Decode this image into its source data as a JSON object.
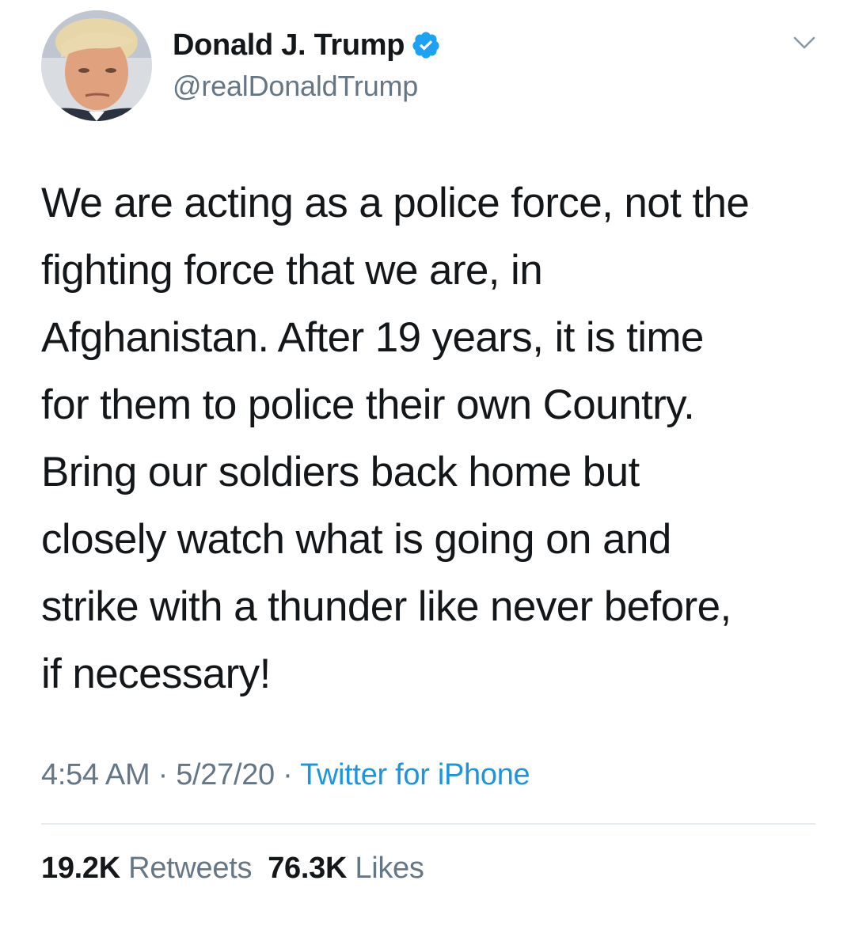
{
  "author": {
    "display_name": "Donald J. Trump",
    "handle": "@realDonaldTrump",
    "verified": true,
    "verified_icon": "verified-badge-icon",
    "avatar": "profile-photo"
  },
  "tweet": {
    "lines": [
      "We are acting as a police force, not the",
      "fighting force that we are, in",
      "Afghanistan. After 19 years, it is time",
      "for them to police their own Country.",
      "Bring our soldiers back home but",
      "closely watch what is going on and",
      "strike with a thunder like never before,",
      "if necessary!"
    ]
  },
  "meta": {
    "time": "4:54 AM",
    "separator": " · ",
    "date": "5/27/20",
    "source": "Twitter for iPhone"
  },
  "stats": {
    "retweets_count": "19.2K",
    "retweets_label": "Retweets",
    "likes_count": "76.3K",
    "likes_label": "Likes"
  },
  "colors": {
    "text": "#14171a",
    "secondary": "#657786",
    "link": "#1b95e0",
    "verified": "#1da1f2",
    "divider": "#e6ecf0"
  },
  "icons": {
    "more": "chevron-down-icon",
    "verified": "verified-badge-icon"
  }
}
